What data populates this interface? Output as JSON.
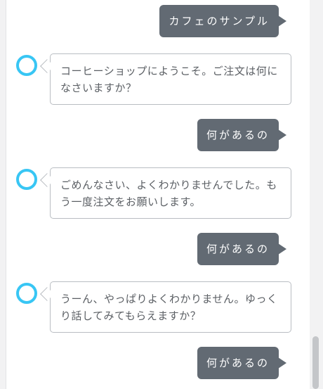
{
  "conversation": {
    "messages": [
      {
        "role": "user",
        "text": "カフェのサンプル"
      },
      {
        "role": "assistant",
        "text": "コーヒーショップにようこそ。ご注文は何になさいますか？"
      },
      {
        "role": "user",
        "text": "何があるの"
      },
      {
        "role": "assistant",
        "text": "ごめんなさい、よくわかりませんでした。もう一度注文をお願いします。"
      },
      {
        "role": "user",
        "text": "何があるの"
      },
      {
        "role": "assistant",
        "text": "うーん、やっぱりよくわかりません。ゆっくり話してみてもらえますか？"
      },
      {
        "role": "user",
        "text": "何があるの"
      }
    ]
  },
  "theme": {
    "user_bubble": "#626a73",
    "assistant_border": "#b9bdc2",
    "avatar_ring": "#38c6f4",
    "avatar_icon": "assistant-ring-icon"
  }
}
